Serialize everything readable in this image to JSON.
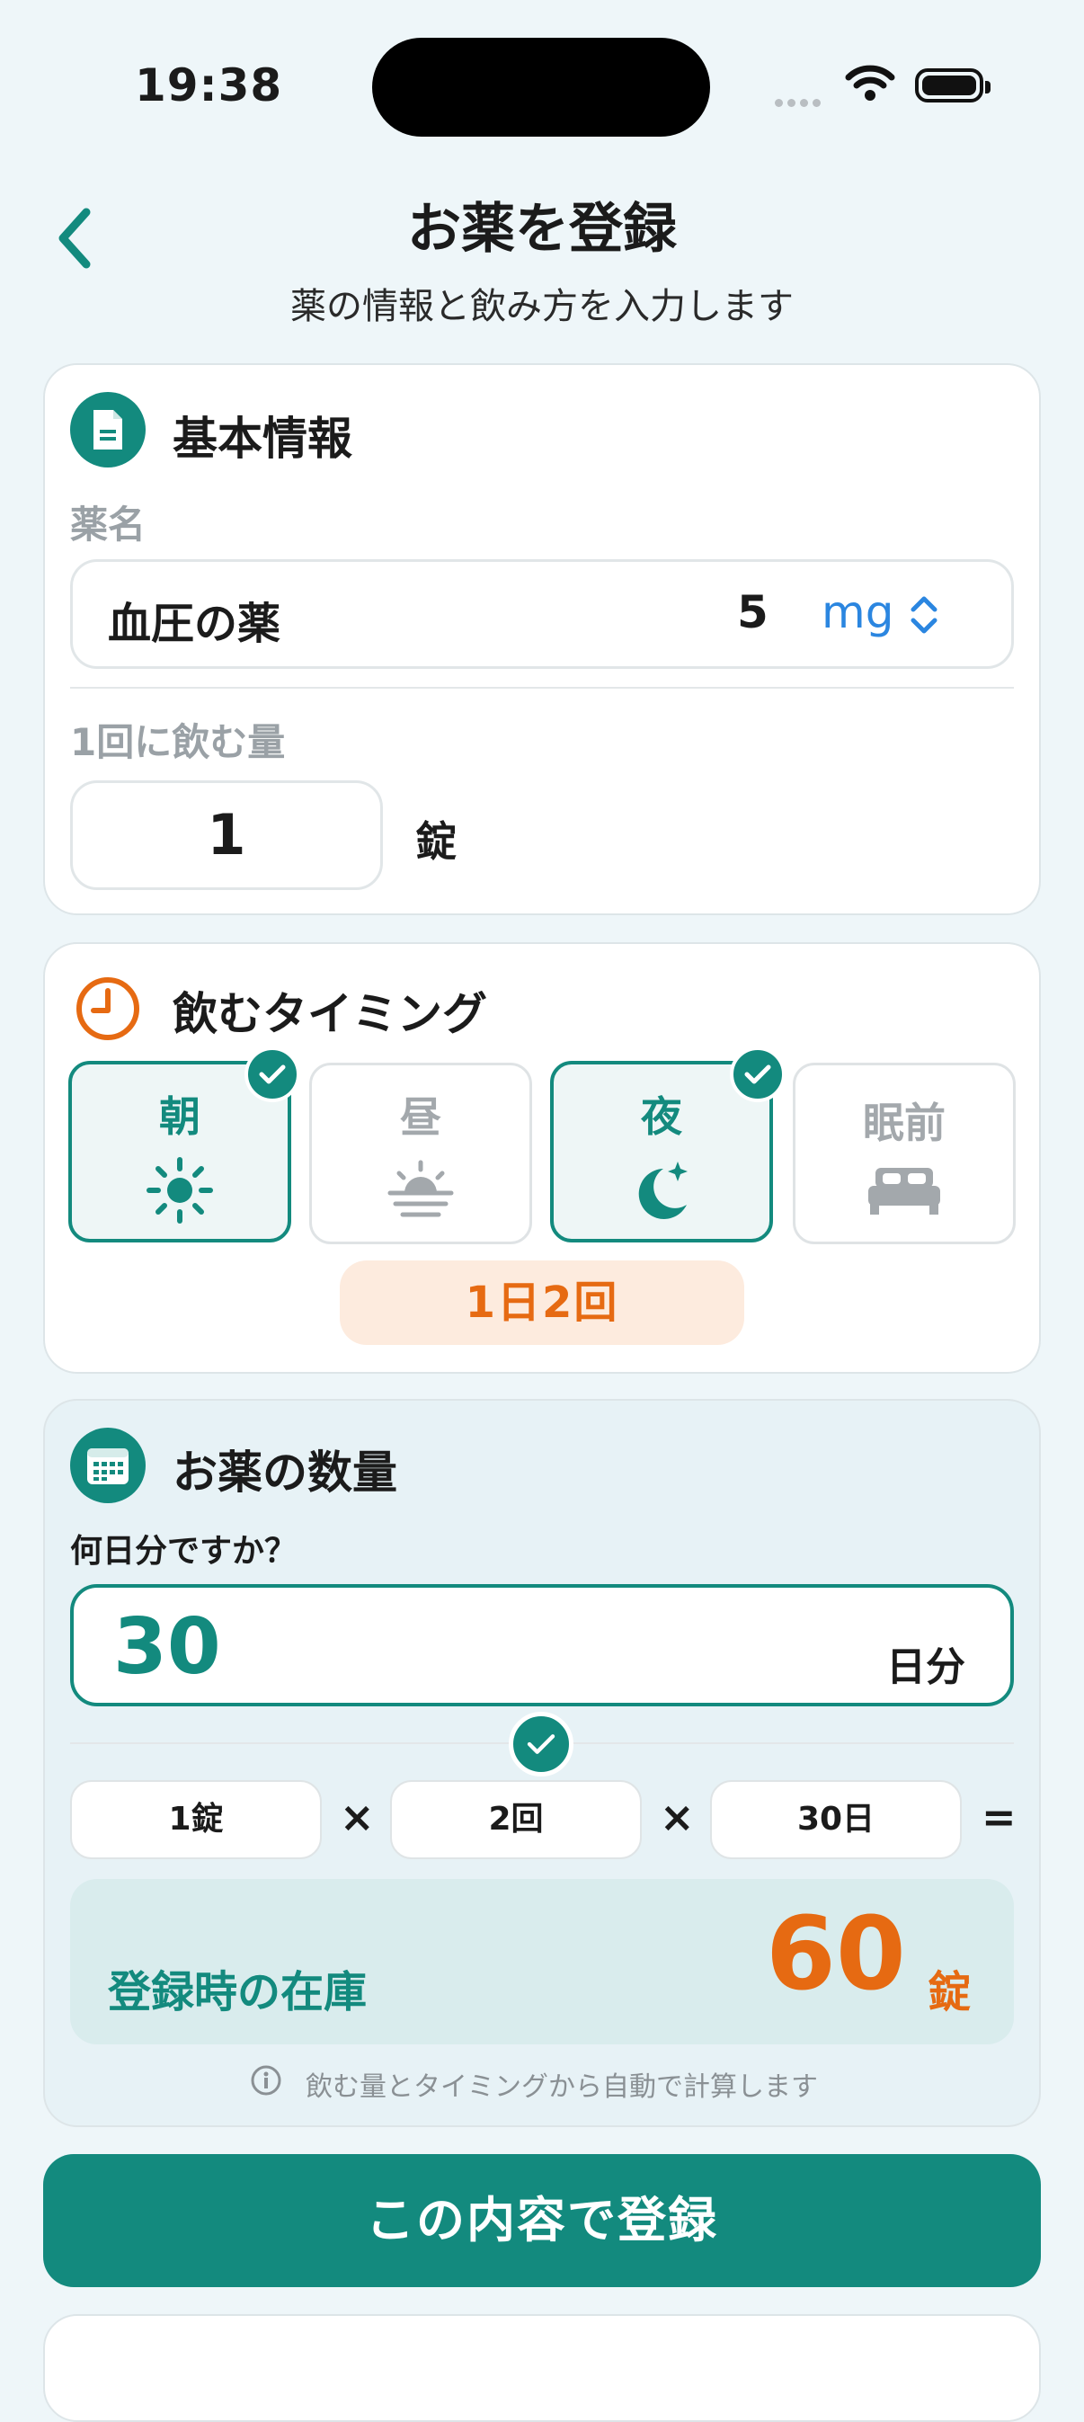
{
  "status": {
    "time": "19:38"
  },
  "header": {
    "title": "お薬を登録",
    "subtitle": "薬の情報と飲み方を入力します"
  },
  "basic_info": {
    "title": "基本情報",
    "name_label": "薬名",
    "name_value": "血圧の薬",
    "strength_value": "5",
    "unit_value": "mg",
    "dose_label": "1回に飲む量",
    "dose_value": "1",
    "dose_unit": "錠"
  },
  "timing": {
    "title": "飲むタイミング",
    "options": [
      {
        "label": "朝",
        "icon": "sun-icon",
        "selected": true
      },
      {
        "label": "昼",
        "icon": "sunset-icon",
        "selected": false
      },
      {
        "label": "夜",
        "icon": "moon-icon",
        "selected": true
      },
      {
        "label": "眠前",
        "icon": "bed-icon",
        "selected": false
      }
    ],
    "summary": "1日2回"
  },
  "quantity": {
    "title": "お薬の数量",
    "days_question": "何日分ですか？",
    "days_value": "30",
    "days_unit": "日分",
    "calc": {
      "per_dose": "1錠",
      "times": "2回",
      "days": "30日",
      "times_sign": "×",
      "equals_sign": "="
    },
    "stock_label": "登録時の在庫",
    "stock_value": "60",
    "stock_unit": "錠",
    "note": "飲む量とタイミングから自動で計算します"
  },
  "submit_label": "この内容で登録",
  "colors": {
    "accent": "#138a7e",
    "orange": "#e66a12",
    "blue": "#2b86e0",
    "background": "#eef6f9"
  }
}
